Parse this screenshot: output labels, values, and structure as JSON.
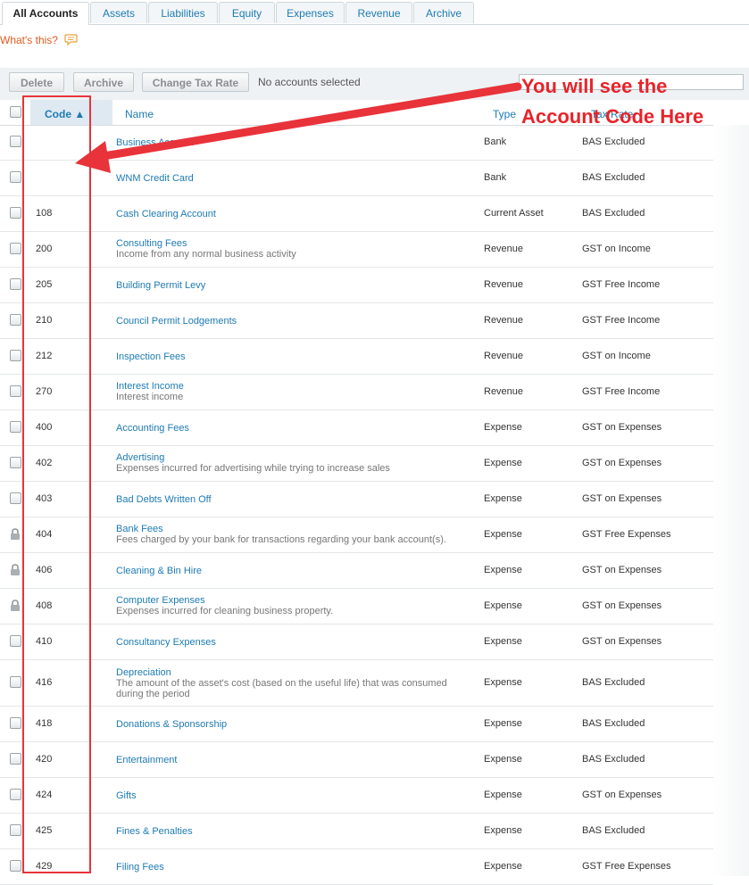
{
  "tabs": [
    {
      "label": "All Accounts",
      "active": true
    },
    {
      "label": "Assets"
    },
    {
      "label": "Liabilities"
    },
    {
      "label": "Equity"
    },
    {
      "label": "Expenses"
    },
    {
      "label": "Revenue"
    },
    {
      "label": "Archive"
    }
  ],
  "whats_this": "What's this?",
  "toolbar": {
    "delete_label": "Delete",
    "archive_label": "Archive",
    "change_tax_label": "Change Tax Rate",
    "status": "No accounts selected"
  },
  "table": {
    "headers": {
      "code": "Code ▲",
      "name": "Name",
      "type": "Type",
      "tax": "Tax Rate"
    },
    "rows": [
      {
        "code": "",
        "name": "Business Account",
        "desc": "",
        "type": "Bank",
        "tax": "BAS Excluded",
        "locked": false
      },
      {
        "code": "",
        "name": "WNM Credit Card",
        "desc": "",
        "type": "Bank",
        "tax": "BAS Excluded",
        "locked": false
      },
      {
        "code": "108",
        "name": "Cash Clearing Account",
        "desc": "",
        "type": "Current Asset",
        "tax": "BAS Excluded",
        "locked": false
      },
      {
        "code": "200",
        "name": "Consulting Fees",
        "desc": "Income from any normal business activity",
        "type": "Revenue",
        "tax": "GST on Income",
        "locked": false
      },
      {
        "code": "205",
        "name": "Building Permit Levy",
        "desc": "",
        "type": "Revenue",
        "tax": "GST Free Income",
        "locked": false
      },
      {
        "code": "210",
        "name": "Council Permit Lodgements",
        "desc": "",
        "type": "Revenue",
        "tax": "GST Free Income",
        "locked": false
      },
      {
        "code": "212",
        "name": "Inspection Fees",
        "desc": "",
        "type": "Revenue",
        "tax": "GST on Income",
        "locked": false
      },
      {
        "code": "270",
        "name": "Interest Income",
        "desc": "Interest income",
        "type": "Revenue",
        "tax": "GST Free Income",
        "locked": false
      },
      {
        "code": "400",
        "name": "Accounting Fees",
        "desc": "",
        "type": "Expense",
        "tax": "GST on Expenses",
        "locked": false
      },
      {
        "code": "402",
        "name": "Advertising",
        "desc": "Expenses incurred for advertising while trying to increase sales",
        "type": "Expense",
        "tax": "GST on Expenses",
        "locked": false
      },
      {
        "code": "403",
        "name": "Bad Debts Written Off",
        "desc": "",
        "type": "Expense",
        "tax": "GST on Expenses",
        "locked": false
      },
      {
        "code": "404",
        "name": "Bank Fees",
        "desc": "Fees charged by your bank for transactions regarding your bank account(s).",
        "type": "Expense",
        "tax": "GST Free Expenses",
        "locked": true
      },
      {
        "code": "406",
        "name": "Cleaning & Bin Hire",
        "desc": "",
        "type": "Expense",
        "tax": "GST on Expenses",
        "locked": true
      },
      {
        "code": "408",
        "name": "Computer Expenses",
        "desc": "Expenses incurred for cleaning business property.",
        "type": "Expense",
        "tax": "GST on Expenses",
        "locked": true
      },
      {
        "code": "410",
        "name": "Consultancy Expenses",
        "desc": "",
        "type": "Expense",
        "tax": "GST on Expenses",
        "locked": false
      },
      {
        "code": "416",
        "name": "Depreciation",
        "desc": "The amount of the asset's cost (based on the useful life) that was consumed during the period",
        "type": "Expense",
        "tax": "BAS Excluded",
        "locked": false
      },
      {
        "code": "418",
        "name": "Donations & Sponsorship",
        "desc": "",
        "type": "Expense",
        "tax": "BAS Excluded",
        "locked": false
      },
      {
        "code": "420",
        "name": "Entertainment",
        "desc": "",
        "type": "Expense",
        "tax": "BAS Excluded",
        "locked": false
      },
      {
        "code": "424",
        "name": "Gifts",
        "desc": "",
        "type": "Expense",
        "tax": "GST on Expenses",
        "locked": false
      },
      {
        "code": "425",
        "name": "Fines & Penalties",
        "desc": "",
        "type": "Expense",
        "tax": "BAS Excluded",
        "locked": false
      },
      {
        "code": "429",
        "name": "Filing Fees",
        "desc": "",
        "type": "Expense",
        "tax": "GST Free Expenses",
        "locked": false
      }
    ]
  },
  "annotation": {
    "line1": "You will see the",
    "line2": "Account Code Here",
    "color": "#e8232a"
  },
  "colors": {
    "link": "#1e7bb3",
    "accent_orange": "#e05a1c",
    "annotation_red": "#e8333a"
  }
}
